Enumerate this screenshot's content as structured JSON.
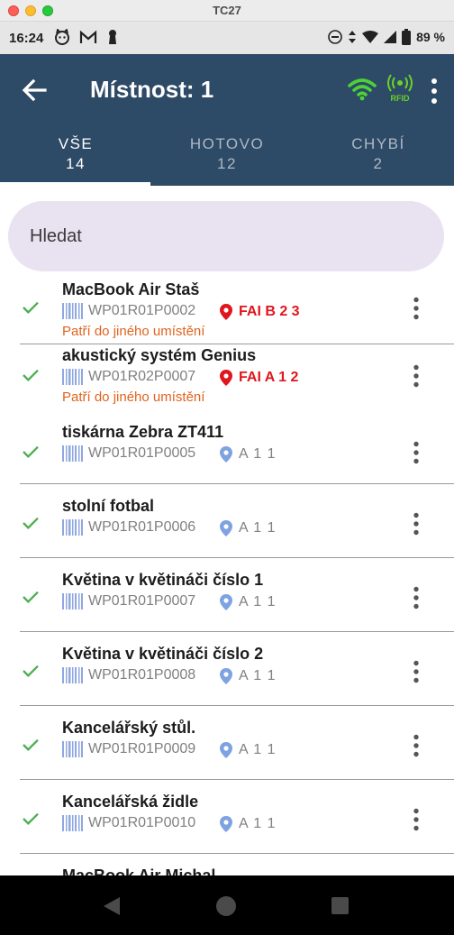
{
  "window": {
    "title": "TC27"
  },
  "status_bar": {
    "time": "16:24",
    "battery": "89 %"
  },
  "appbar": {
    "title": "Místnost: 1",
    "rfid_label": "RFID"
  },
  "tabs": [
    {
      "label": "VŠE",
      "count": "14"
    },
    {
      "label": "HOTOVO",
      "count": "12"
    },
    {
      "label": "CHYBÍ",
      "count": "2"
    }
  ],
  "search": {
    "placeholder": "Hledat"
  },
  "items": [
    {
      "name": "MacBook Air Staš",
      "code": "WP01R01P0002",
      "location": "FAI B 2 3",
      "warning": "Patří do jiného umístění"
    },
    {
      "name": "akustický systém Genius",
      "code": "WP01R02P0007",
      "location": "FAI A 1 2",
      "warning": "Patří do jiného umístění"
    },
    {
      "name": "tiskárna Zebra ZT411",
      "code": "WP01R01P0005",
      "location": "A 1 1"
    },
    {
      "name": "stolní fotbal",
      "code": "WP01R01P0006",
      "location": "A 1 1"
    },
    {
      "name": "Květina v květináči číslo 1",
      "code": "WP01R01P0007",
      "location": "A 1 1"
    },
    {
      "name": "Květina v květináči číslo 2",
      "code": "WP01R01P0008",
      "location": "A 1 1"
    },
    {
      "name": "Kancelářský stůl.",
      "code": "WP01R01P0009",
      "location": "A 1 1"
    },
    {
      "name": "Kancelářská židle",
      "code": "WP01R01P0010",
      "location": "A 1 1"
    },
    {
      "name": "MacBook Air Michal"
    }
  ],
  "colors": {
    "appbar": "#2d4a66",
    "check": "#4caf50",
    "warning": "#e0631e",
    "bad_location": "#e0161e",
    "ok_location": "#7fa2e0",
    "wifi": "#4cd137"
  }
}
